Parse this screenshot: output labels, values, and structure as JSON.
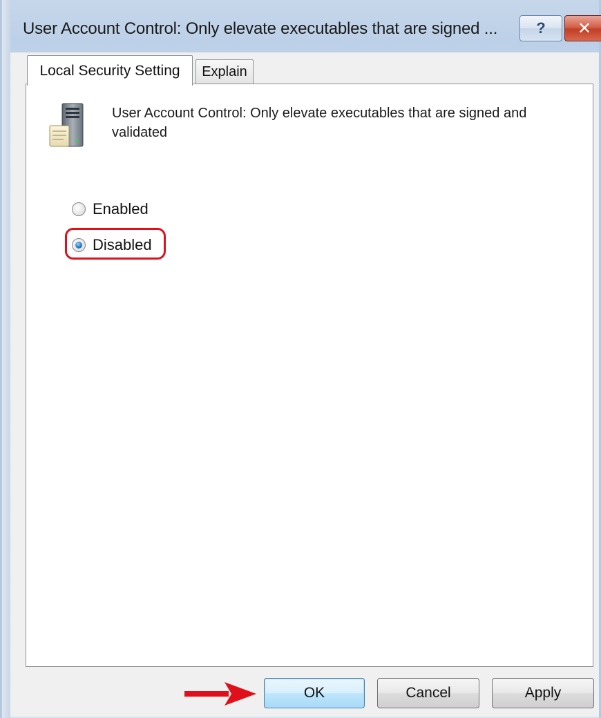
{
  "window": {
    "title": "User Account Control: Only elevate executables that are signed ...",
    "help_label": "?",
    "close_label": "✕"
  },
  "tabs": [
    {
      "label": "Local Security Setting",
      "active": true
    },
    {
      "label": "Explain",
      "active": false
    }
  ],
  "policy": {
    "icon": "server-policy-icon",
    "name": "User Account Control: Only elevate executables that are signed and validated"
  },
  "options": [
    {
      "label": "Enabled",
      "selected": false
    },
    {
      "label": "Disabled",
      "selected": true
    }
  ],
  "annotations": {
    "highlight_color": "#e0101a",
    "arrow_color": "#e0101a"
  },
  "buttons": {
    "ok_label": "OK",
    "cancel_label": "Cancel",
    "apply_label": "Apply"
  }
}
